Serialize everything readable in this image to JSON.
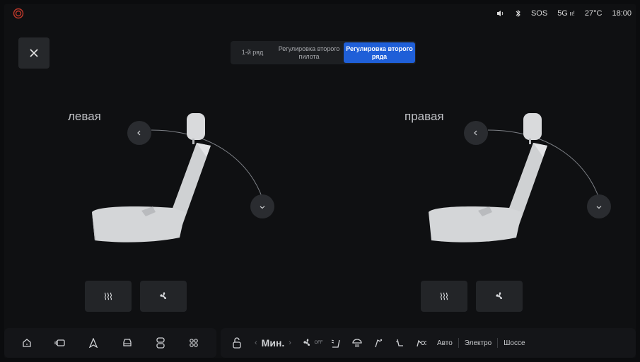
{
  "status": {
    "alert_icon": "warning-circle-icon",
    "volume_icon": "volume-icon",
    "bluetooth_icon": "bluetooth-icon",
    "sos": "SOS",
    "network": "5G",
    "temperature": "27°C",
    "time": "18:00"
  },
  "tabs": [
    {
      "label": "1-й ряд"
    },
    {
      "label": "Регулировка второго пилота"
    },
    {
      "label": "Регулировка второго ряда",
      "active": true
    }
  ],
  "left_seat": {
    "label": "левая"
  },
  "right_seat": {
    "label": "правая"
  },
  "bottom": {
    "mode_value": "Мин.",
    "fan_state": "OFF",
    "modes": [
      "Авто",
      "Электро",
      "Шоссе"
    ]
  },
  "colors": {
    "accent": "#1f5fd8",
    "background": "#0f1012",
    "button": "#232528"
  }
}
